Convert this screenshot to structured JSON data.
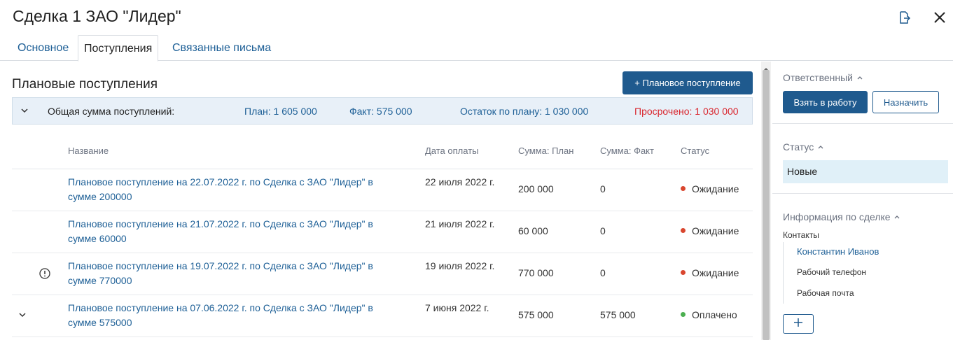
{
  "header": {
    "title": "Сделка 1 ЗАО \"Лидер\"",
    "export_icon": "export-icon",
    "close_icon": "close-icon"
  },
  "tabs": [
    {
      "label": "Основное",
      "active": false
    },
    {
      "label": "Поступления",
      "active": true
    },
    {
      "label": "Связанные письма",
      "active": false
    }
  ],
  "main": {
    "section_title": "Плановые поступления",
    "add_button": "+ Плановое поступление",
    "summary": {
      "label": "Общая сумма поступлений:",
      "plan_label": "План:",
      "plan_value": "1 605 000",
      "fact_label": "Факт:",
      "fact_value": "575 000",
      "rest_label": "Остаток по плану:",
      "rest_value": "1 030 000",
      "overdue_label": "Просрочено:",
      "overdue_value": "1 030 000"
    },
    "columns": [
      "Название",
      "Дата оплаты",
      "Сумма: План",
      "Сумма: Факт",
      "Статус"
    ],
    "rows": [
      {
        "name": "Плановое поступление на 22.07.2022 г. по Сделка с ЗАО \"Лидер\" в сумме 200000",
        "date": "22 июля 2022 г.",
        "plan": "200 000",
        "fact": "0",
        "status": "Ожидание",
        "status_color": "#d9462e",
        "lead": ""
      },
      {
        "name": "Плановое поступление на 21.07.2022 г. по Сделка с ЗАО \"Лидер\" в сумме 60000",
        "date": "21 июля 2022 г.",
        "plan": "60 000",
        "fact": "0",
        "status": "Ожидание",
        "status_color": "#d9462e",
        "lead": ""
      },
      {
        "name": "Плановое поступление на 19.07.2022 г. по Сделка с ЗАО \"Лидер\" в сумме 770000",
        "date": "19 июля 2022 г.",
        "plan": "770 000",
        "fact": "0",
        "status": "Ожидание",
        "status_color": "#d9462e",
        "lead": "warning-icon"
      },
      {
        "name": "Плановое поступление на 07.06.2022 г. по Сделка с ЗАО \"Лидер\" в сумме 575000",
        "date": "7 июня 2022 г.",
        "plan": "575 000",
        "fact": "575 000",
        "status": "Оплачено",
        "status_color": "#4caf50",
        "lead": "chevron-down-icon"
      }
    ]
  },
  "sidebar": {
    "responsible_heading": "Ответственный",
    "take_button": "Взять в работу",
    "assign_button": "Назначить",
    "status_heading": "Статус",
    "status_value": "Новые",
    "deal_info_heading": "Информация по сделке",
    "contacts_label": "Контакты",
    "contact_name": "Константин Иванов",
    "work_phone": "Рабочий телефон",
    "work_email": "Рабочая почта",
    "add_icon": "plus-icon"
  },
  "colors": {
    "accent": "#1f5a8e",
    "link": "#1d5f96",
    "overdue": "#d9262e",
    "summary_bg": "#e8f0f8",
    "status_bg": "#e0f0f8"
  }
}
